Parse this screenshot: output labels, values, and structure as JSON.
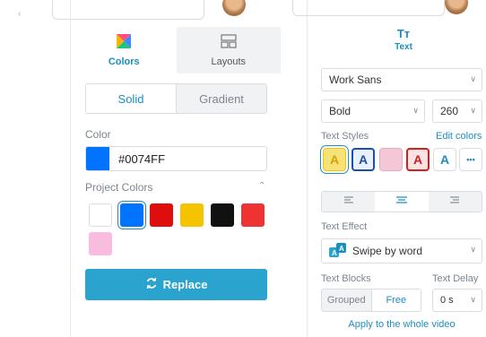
{
  "left_panel": {
    "tabs": [
      {
        "label": "Colors",
        "icon": "colors-icon"
      },
      {
        "label": "Layouts",
        "icon": "layouts-icon"
      }
    ],
    "mode_toggle": {
      "solid": "Solid",
      "gradient": "Gradient"
    },
    "color_label": "Color",
    "color_value": "#0074FF",
    "project_colors_label": "Project Colors",
    "project_colors": [
      "#ffffff",
      "#0074ff",
      "#e00d0d",
      "#f5c400",
      "#111111",
      "#ef3232",
      "#f7bce0"
    ],
    "replace_button": "Replace"
  },
  "right_panel": {
    "text_tab": {
      "icon_label": "Tт",
      "label": "Text"
    },
    "font_family": "Work Sans",
    "font_weight": "Bold",
    "font_size": "260",
    "text_styles_label": "Text Styles",
    "edit_colors": "Edit colors",
    "text_style_glyph": "A",
    "more_glyph": "•••",
    "text_effect_label": "Text Effect",
    "text_effect_value": "Swipe by word",
    "text_blocks_label": "Text Blocks",
    "text_delay_label": "Text Delay",
    "text_blocks_options": {
      "grouped": "Grouped",
      "free": "Free"
    },
    "text_delay_value": "0 s",
    "apply_link": "Apply to the whole video"
  },
  "colors": {
    "accent": "#1a8fbf",
    "button": "#2aa3cf",
    "selected_color": "#0074FF"
  }
}
